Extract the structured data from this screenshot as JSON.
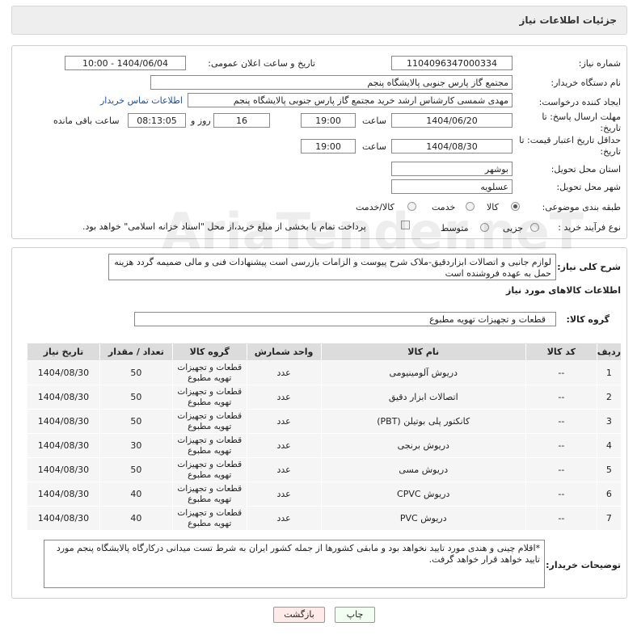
{
  "header": {
    "title": "جزئیات اطلاعات نیاز"
  },
  "form": {
    "need_number_label": "شماره نیاز:",
    "need_number": "1104096347000334",
    "announce_label": "تاریخ و ساعت اعلان عمومی:",
    "announce_value": "1404/06/04 - 10:00",
    "buyer_org_label": "نام دستگاه خریدار:",
    "buyer_org": "مجتمع گاز پارس جنوبی  پالایشگاه پنجم",
    "creator_label": "ایجاد کننده درخواست:",
    "creator": "مهدی شمسی کارشناس ارشد خرید مجتمع گاز پارس جنوبی  پالایشگاه پنجم",
    "contact_link": "اطلاعات تماس خریدار",
    "reply_deadline_label": "مهلت ارسال پاسخ: تا تاریخ:",
    "reply_date": "1404/06/20",
    "time_label": "ساعت",
    "reply_time": "19:00",
    "days": "16",
    "days_label": "روز و",
    "remaining_time": "08:13:05",
    "remaining_label": "ساعت باقی مانده",
    "price_validity_label": "حداقل تاریخ اعتبار قیمت: تا تاریخ:",
    "price_date": "1404/08/30",
    "price_time": "19:00",
    "province_label": "استان محل تحویل:",
    "province": "بوشهر",
    "city_label": "شهر محل تحویل:",
    "city": "عسلویه",
    "category_label": "طبقه بندی موضوعی:",
    "category_options": [
      "کالا",
      "خدمت",
      "کالا/خدمت"
    ],
    "category_selected": "کالا",
    "process_label": "نوع فرآیند خرید :",
    "process_options": [
      "جزیی",
      "متوسط"
    ],
    "payment_note": "پرداخت تمام یا بخشی از مبلغ خرید،از محل \"اسناد خزانه اسلامی\" خواهد بود."
  },
  "description": {
    "label": "شرح کلی نیاز:",
    "text": "لوازم جانبی و اتصالات ابزاردقیق-ملاک شرح پیوست و الزامات بازرسی است پیشنهادات فنی و مالی ضمیمه گردد هزینه حمل به عهده فروشنده است"
  },
  "goods": {
    "section_title": "اطلاعات کالاهای مورد نیاز",
    "group_label": "گروه کالا:",
    "group_value": "قطعات و تجهیزات تهویه مطبوع",
    "columns": [
      "ردیف",
      "کد کالا",
      "نام کالا",
      "واحد شمارش",
      "گروه کالا",
      "تعداد / مقدار",
      "تاریخ نیاز"
    ],
    "rows": [
      {
        "row": "1",
        "code": "--",
        "name": "دریوش آلومینیومی",
        "unit": "عدد",
        "group": "قطعات و تجهیزات تهویه مطبوع",
        "qty": "50",
        "date": "1404/08/30"
      },
      {
        "row": "2",
        "code": "--",
        "name": "اتصالات ابزار دقیق",
        "unit": "عدد",
        "group": "قطعات و تجهیزات تهویه مطبوع",
        "qty": "50",
        "date": "1404/08/30"
      },
      {
        "row": "3",
        "code": "--",
        "name": "کانکتور پلی بوتیلن (PBT)",
        "unit": "عدد",
        "group": "قطعات و تجهیزات تهویه مطبوع",
        "qty": "50",
        "date": "1404/08/30"
      },
      {
        "row": "4",
        "code": "--",
        "name": "دریوش برنجی",
        "unit": "عدد",
        "group": "قطعات و تجهیزات تهویه مطبوع",
        "qty": "30",
        "date": "1404/08/30"
      },
      {
        "row": "5",
        "code": "--",
        "name": "دریوش مسی",
        "unit": "عدد",
        "group": "قطعات و تجهیزات تهویه مطبوع",
        "qty": "50",
        "date": "1404/08/30"
      },
      {
        "row": "6",
        "code": "--",
        "name": "دریوش CPVC",
        "unit": "عدد",
        "group": "قطعات و تجهیزات تهویه مطبوع",
        "qty": "40",
        "date": "1404/08/30"
      },
      {
        "row": "7",
        "code": "--",
        "name": "دریوش PVC",
        "unit": "عدد",
        "group": "قطعات و تجهیزات تهویه مطبوع",
        "qty": "40",
        "date": "1404/08/30"
      }
    ]
  },
  "buyer_notes": {
    "label": "توضیحات خریدار:",
    "text": "*اقلام چینی و هندی مورد تایید نخواهد بود و مابقی کشورها از جمله کشور ایران به شرط تست میدانی  درکارگاه پالایشگاه پنجم مورد تایید خواهد قرار خواهد گرفت."
  },
  "buttons": {
    "print": "چاپ",
    "back": "بازگشت"
  },
  "watermark": "AriaTender.neT"
}
